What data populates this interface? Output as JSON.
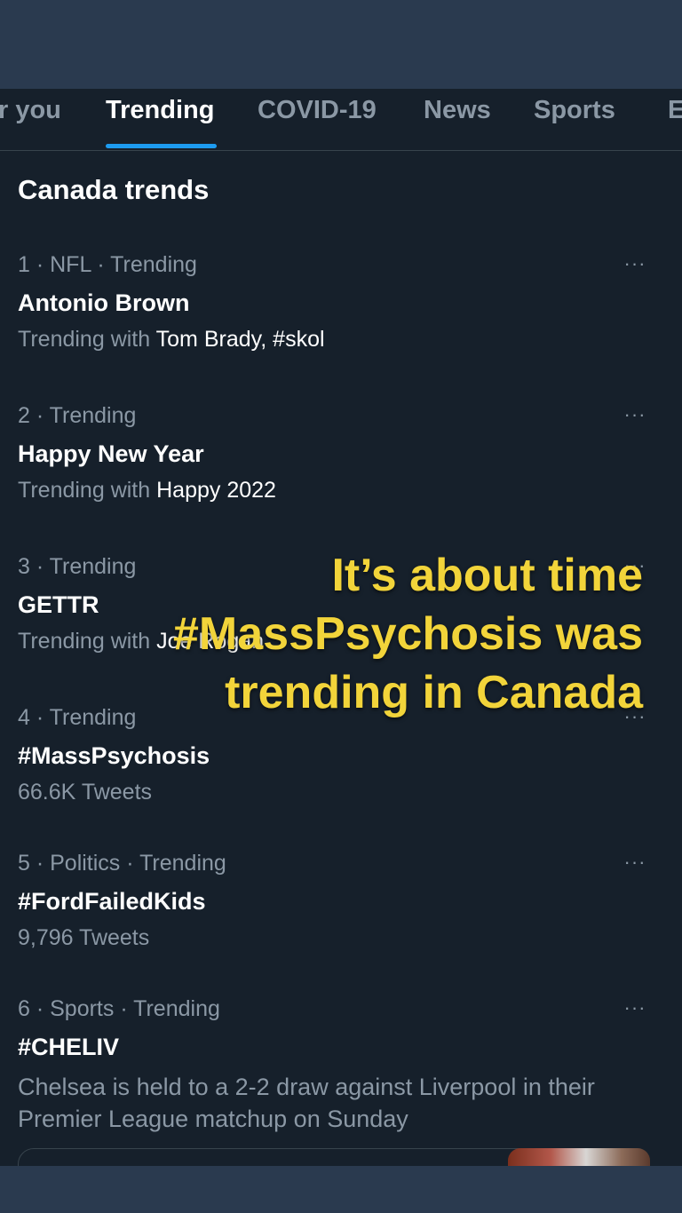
{
  "tabs": [
    {
      "label": "r you"
    },
    {
      "label": "Trending"
    },
    {
      "label": "COVID-19"
    },
    {
      "label": "News"
    },
    {
      "label": "Sports"
    },
    {
      "label": "E"
    }
  ],
  "section_title": "Canada trends",
  "trends": [
    {
      "meta": "1 · NFL · Trending",
      "name": "Antonio Brown",
      "sub_prefix": "Trending with",
      "sub_highlight": "Tom Brady, #skol"
    },
    {
      "meta": "2 · Trending",
      "name": "Happy New Year",
      "sub_prefix": "Trending with",
      "sub_highlight": "Happy 2022"
    },
    {
      "meta": "3 · Trending",
      "name": "GETTR",
      "sub_prefix": "Trending with",
      "sub_highlight": "Joe Rogan"
    },
    {
      "meta": "4 · Trending",
      "name": "#MassPsychosis",
      "sub_text": "66.6K Tweets"
    },
    {
      "meta": "5 · Politics · Trending",
      "name": "#FordFailedKids",
      "sub_text": "9,796 Tweets"
    },
    {
      "meta": "6 · Sports · Trending",
      "name": "#CHELIV",
      "description": "Chelsea is held to a 2-2 draw against Liverpool in their Premier League matchup on Sunday"
    }
  ],
  "more_label": "···",
  "overlay": {
    "line1": "It’s about time",
    "line2": "#MassPsychosis was",
    "line3": "trending in Canada"
  },
  "colors": {
    "background": "#16202b",
    "frame": "#2a3a4f",
    "accent": "#1d9bf0",
    "overlay_text": "#f2d43a",
    "muted_text": "#8b98a5"
  }
}
